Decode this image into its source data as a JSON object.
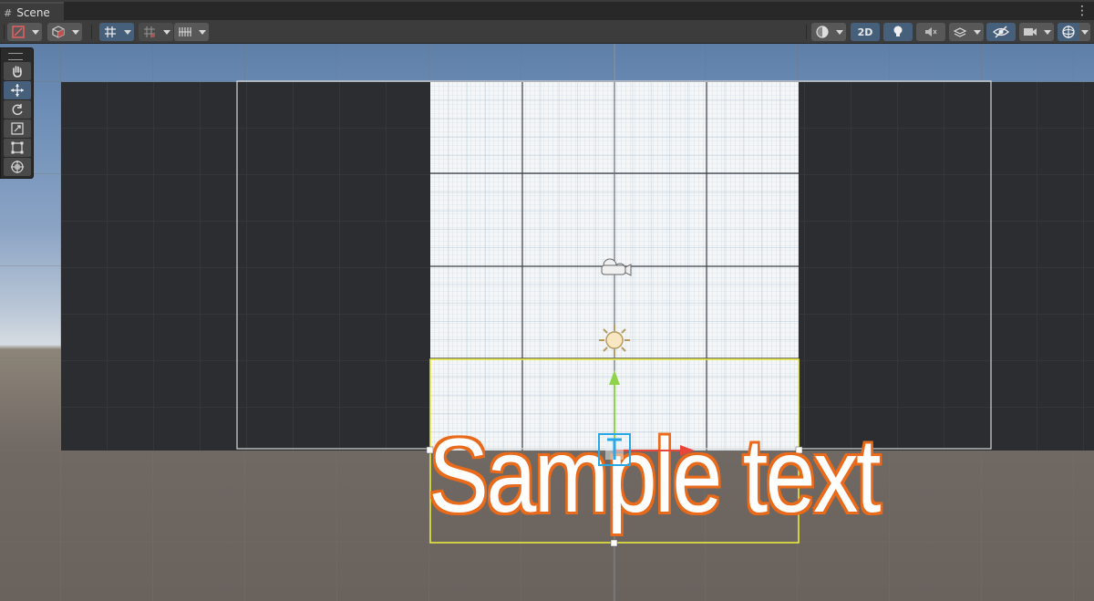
{
  "window": {
    "tab_title": "Scene",
    "tab_icon": "grid-icon",
    "menu_icon": "kebab-menu-icon"
  },
  "toolbar": {
    "left": [
      {
        "name": "draw-mode-dropdown",
        "icon": "shaded-brush-icon"
      },
      {
        "name": "render-mode-dropdown",
        "icon": "cube-icon"
      },
      {
        "name": "grid-snap-toggle",
        "icon": "grid-snap-icon",
        "active": true
      },
      {
        "name": "increment-snap-dropdown",
        "icon": "snap-grid-icon"
      },
      {
        "name": "grid-visibility-dropdown",
        "icon": "ruler-grid-icon"
      }
    ],
    "right": [
      {
        "name": "shading-mode-dropdown",
        "icon": "sphere-half-icon"
      },
      {
        "name": "2d-toggle",
        "label": "2D",
        "active": true
      },
      {
        "name": "lighting-toggle",
        "icon": "lightbulb-icon",
        "active": true
      },
      {
        "name": "audio-toggle",
        "icon": "speaker-muted-icon"
      },
      {
        "name": "effects-dropdown",
        "icon": "layers-effects-icon"
      },
      {
        "name": "scene-visibility-toggle",
        "icon": "eye-hidden-icon",
        "active": true
      },
      {
        "name": "camera-dropdown",
        "icon": "camera-icon"
      },
      {
        "name": "gizmos-dropdown",
        "icon": "gizmo-sphere-icon",
        "active": true
      }
    ]
  },
  "tools": [
    {
      "name": "hand-tool",
      "icon": "hand-icon"
    },
    {
      "name": "move-tool",
      "icon": "move-arrows-icon",
      "active": true
    },
    {
      "name": "rotate-tool",
      "icon": "rotate-icon"
    },
    {
      "name": "scale-tool",
      "icon": "scale-icon"
    },
    {
      "name": "rect-tool",
      "icon": "rect-transform-icon"
    },
    {
      "name": "transform-tool",
      "icon": "transform-all-icon"
    }
  ],
  "scene": {
    "text_object": "Sample text",
    "colors": {
      "selection_outline": "#e86a1a",
      "rect_gizmo": "#f2f23a",
      "y_axis": "#8fd34a",
      "x_axis": "#e8463a",
      "text_gizmo": "#29a8e8",
      "canvas_bg": "#f4f6f8",
      "scene_grid_dark": "#2b2d30"
    },
    "gizmo_icons": [
      "camera-gizmo-icon",
      "light-sun-gizmo-icon",
      "text-t-gizmo-icon"
    ]
  }
}
